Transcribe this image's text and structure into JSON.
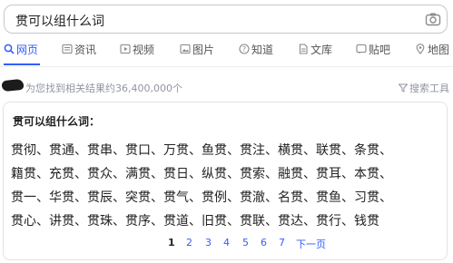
{
  "search": {
    "query": "贯可以组什么词"
  },
  "tabs": [
    {
      "label": "网页",
      "icon": "search-icon",
      "active": true
    },
    {
      "label": "资讯",
      "icon": "news-icon"
    },
    {
      "label": "视频",
      "icon": "video-icon"
    },
    {
      "label": "图片",
      "icon": "image-icon"
    },
    {
      "label": "知道",
      "icon": "question-icon"
    },
    {
      "label": "文库",
      "icon": "document-icon"
    },
    {
      "label": "贴吧",
      "icon": "tieba-icon"
    },
    {
      "label": "地图",
      "icon": "map-icon"
    }
  ],
  "results": {
    "count_text": "为您找到相关结果约36,400,000个",
    "tools_label": "搜索工具"
  },
  "card": {
    "title": "贯可以组什么词：",
    "rows": [
      "贯彻、贯通、贯串、贯口、万贯、鱼贯、贯注、横贯、联贯、条贯、",
      "籍贯、充贯、贯众、满贯、贯日、纵贯、贯索、融贯、贯耳、本贯、",
      "贯一、华贯、贯辰、突贯、贯气、贯例、贯澈、名贯、贯鱼、习贯、",
      "贯心、讲贯、贯珠、贯序、贯道、旧贯、贯联、贯达、贯行、钱贯"
    ]
  },
  "pagination": {
    "pages": [
      "1",
      "2",
      "3",
      "4",
      "5",
      "6",
      "7"
    ],
    "current": "1",
    "next_label": "下一页"
  },
  "colors": {
    "accent": "#315efb",
    "muted": "#9195a3"
  }
}
